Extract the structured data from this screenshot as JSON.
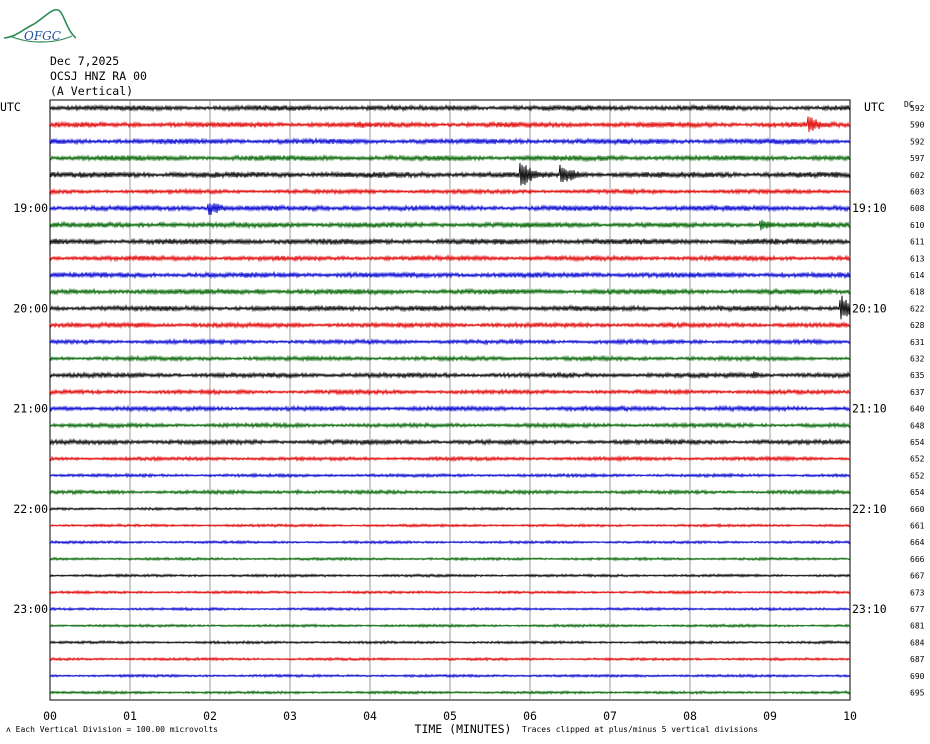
{
  "header": {
    "logo_text": "OFGC",
    "date": "Dec 7,2025",
    "station": "OCSJ HNZ RA 00",
    "component": "(A Vertical)"
  },
  "colors": {
    "trace_cycle": [
      "#000000",
      "#e00000",
      "#0000d0",
      "#006400"
    ],
    "grid": "#808080",
    "logo": "#2e8b57"
  },
  "chart_data": {
    "type": "line",
    "title": "",
    "xlabel": "TIME (MINUTES)",
    "x_range": [
      0,
      10
    ],
    "x_ticks": [
      "00",
      "01",
      "02",
      "03",
      "04",
      "05",
      "06",
      "07",
      "08",
      "09",
      "10"
    ],
    "left_label": "UTC",
    "right_label": "UTC",
    "right_column_label": "DC",
    "left_time_labels": [
      {
        "row": 6,
        "text": "19:00"
      },
      {
        "row": 12,
        "text": "20:00"
      },
      {
        "row": 18,
        "text": "21:00"
      },
      {
        "row": 24,
        "text": "22:00"
      },
      {
        "row": 30,
        "text": "23:00"
      }
    ],
    "right_time_labels": [
      {
        "row": 6,
        "text": "19:10"
      },
      {
        "row": 12,
        "text": "20:10"
      },
      {
        "row": 18,
        "text": "21:10"
      },
      {
        "row": 24,
        "text": "22:10"
      },
      {
        "row": 30,
        "text": "23:10"
      }
    ],
    "dc_offsets": [
      "592",
      "590",
      "592",
      "597",
      "602",
      "603",
      "608",
      "610",
      "611",
      "613",
      "614",
      "618",
      "622",
      "628",
      "631",
      "632",
      "635",
      "637",
      "640",
      "648",
      "654",
      "652",
      "652",
      "654",
      "660",
      "661",
      "664",
      "666",
      "667",
      "673",
      "677",
      "681",
      "684",
      "687",
      "690",
      "695"
    ],
    "row_count": 36,
    "events": [
      {
        "row": 0,
        "minute": 5.05,
        "amp": 2.5,
        "dur": 0.15
      },
      {
        "row": 1,
        "minute": 9.5,
        "amp": 9,
        "dur": 0.35
      },
      {
        "row": 1,
        "minute": 3.9,
        "amp": 3.5,
        "dur": 0.35
      },
      {
        "row": 2,
        "minute": 7.6,
        "amp": 3,
        "dur": 0.25
      },
      {
        "row": 3,
        "minute": 6.9,
        "amp": 3,
        "dur": 0.3
      },
      {
        "row": 4,
        "minute": 5.9,
        "amp": 14,
        "dur": 0.35
      },
      {
        "row": 4,
        "minute": 6.4,
        "amp": 12,
        "dur": 0.35
      },
      {
        "row": 6,
        "minute": 1.2,
        "amp": 3,
        "dur": 0.3
      },
      {
        "row": 6,
        "minute": 2.0,
        "amp": 8,
        "dur": 0.4
      },
      {
        "row": 6,
        "minute": 3.8,
        "amp": 2.5,
        "dur": 0.4
      },
      {
        "row": 7,
        "minute": 8.9,
        "amp": 7,
        "dur": 0.3
      },
      {
        "row": 7,
        "minute": 1.4,
        "amp": 3,
        "dur": 0.2
      },
      {
        "row": 8,
        "minute": 3.7,
        "amp": 3,
        "dur": 0.3
      },
      {
        "row": 11,
        "minute": 2.6,
        "amp": 3,
        "dur": 0.5
      },
      {
        "row": 12,
        "minute": 9.9,
        "amp": 14,
        "dur": 0.25
      },
      {
        "row": 13,
        "minute": 1.1,
        "amp": 3,
        "dur": 0.4
      },
      {
        "row": 16,
        "minute": 8.8,
        "amp": 4,
        "dur": 0.3
      },
      {
        "row": 18,
        "minute": 7.0,
        "amp": 3,
        "dur": 0.2
      },
      {
        "row": 19,
        "minute": 3.1,
        "amp": 2.5,
        "dur": 0.3
      },
      {
        "row": 21,
        "minute": 9.2,
        "amp": 2.5,
        "dur": 0.3
      },
      {
        "row": 23,
        "minute": 3.1,
        "amp": 3,
        "dur": 0.1
      }
    ],
    "noise_base": [
      2.0,
      2.0,
      2.0,
      2.0,
      2.2,
      1.6,
      2.0,
      2.0,
      2.2,
      1.8,
      2.0,
      2.0,
      2.0,
      1.8,
      1.6,
      1.6,
      1.8,
      1.6,
      1.8,
      1.6,
      1.8,
      1.4,
      1.2,
      1.4,
      1.0,
      1.0,
      1.0,
      1.0,
      1.0,
      1.0,
      1.0,
      1.0,
      1.0,
      1.0,
      1.0,
      1.0
    ]
  },
  "footer": {
    "scale": "Each Vertical Division =  100.00 microvolts",
    "clip_note": "Traces clipped at plus/minus 5 vertical divisions"
  }
}
